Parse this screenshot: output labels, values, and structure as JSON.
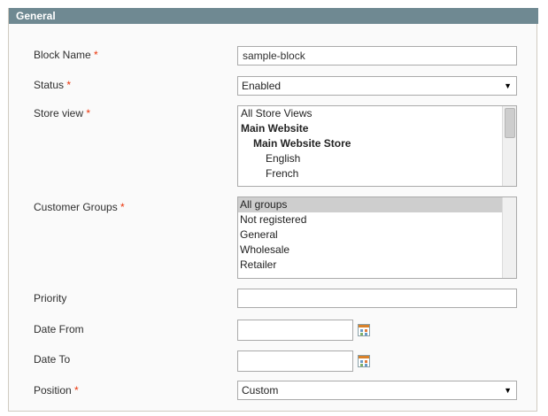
{
  "section": {
    "title": "General"
  },
  "required_mark": "*",
  "block_name": {
    "label": "Block Name",
    "value": "sample-block"
  },
  "status": {
    "label": "Status",
    "value": "Enabled"
  },
  "store_view": {
    "label": "Store view",
    "options": [
      "All Store Views",
      "Main Website",
      "Main Website Store",
      "English",
      "French"
    ]
  },
  "customer_groups": {
    "label": "Customer Groups",
    "options": [
      "All groups",
      "Not registered",
      "General",
      "Wholesale",
      "Retailer"
    ]
  },
  "priority": {
    "label": "Priority",
    "value": ""
  },
  "date_from": {
    "label": "Date From",
    "value": ""
  },
  "date_to": {
    "label": "Date To",
    "value": ""
  },
  "position": {
    "label": "Position",
    "value": "Custom"
  },
  "colors": {
    "header_bg": "#6f8992",
    "required": "#eb340a",
    "selected_option": "#cecece"
  },
  "icons": {
    "dropdown": "triangle-down-icon",
    "calendar": "calendar-icon"
  }
}
